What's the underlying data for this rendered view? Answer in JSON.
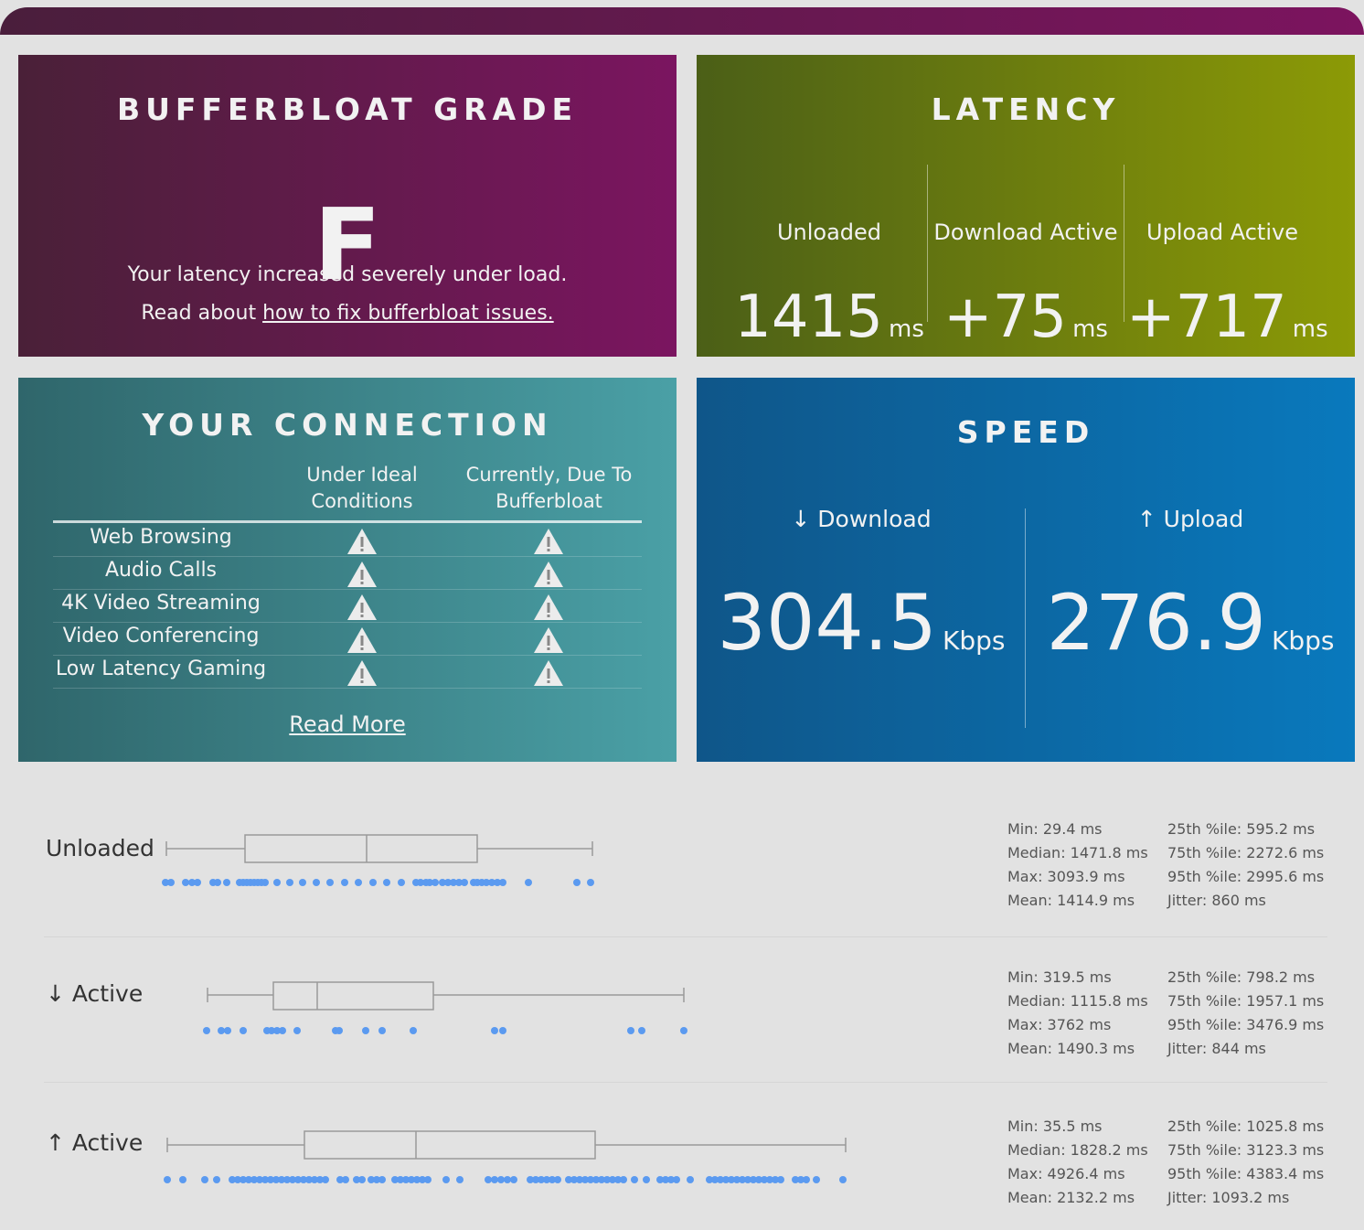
{
  "grade": {
    "title": "BUFFERBLOAT GRADE",
    "letter": "F",
    "message": "Your latency increased severely under load.",
    "read_prefix": "Read about ",
    "link_text": "how to fix bufferbloat issues."
  },
  "latency": {
    "title": "LATENCY",
    "columns": [
      {
        "label": "Unloaded",
        "value": "1415",
        "unit": "ms"
      },
      {
        "label": "Download Active",
        "value": "+75",
        "unit": "ms"
      },
      {
        "label": "Upload Active",
        "value": "+717",
        "unit": "ms"
      }
    ]
  },
  "connection": {
    "title": "YOUR CONNECTION",
    "col_ideal": "Under Ideal Conditions",
    "col_current": "Currently, Due To Bufferbloat",
    "rows": [
      "Web Browsing",
      "Audio Calls",
      "4K Video Streaming",
      "Video Conferencing",
      "Low Latency Gaming"
    ],
    "status_icon": "warning-icon",
    "read_more": "Read More"
  },
  "speed": {
    "title": "SPEED",
    "download": {
      "label": "↓ Download",
      "value": "304.5",
      "unit": "Kbps"
    },
    "upload": {
      "label": "↑ Upload",
      "value": "276.9",
      "unit": "Kbps"
    }
  },
  "stats": [
    {
      "label": "Unloaded",
      "min": "Min: 29.4 ms",
      "median": "Median: 1471.8 ms",
      "max": "Max: 3093.9 ms",
      "mean": "Mean: 1414.9 ms",
      "p25": "25th %ile: 595.2 ms",
      "p75": "75th %ile: 2272.6 ms",
      "p95": "95th %ile: 2995.6 ms",
      "jitter": "Jitter: 860 ms"
    },
    {
      "label": "↓ Active",
      "min": "Min: 319.5 ms",
      "median": "Median: 1115.8 ms",
      "max": "Max: 3762 ms",
      "mean": "Mean: 1490.3 ms",
      "p25": "25th %ile: 798.2 ms",
      "p75": "75th %ile: 1957.1 ms",
      "p95": "95th %ile: 3476.9 ms",
      "jitter": "Jitter: 844 ms"
    },
    {
      "label": "↑ Active",
      "min": "Min: 35.5 ms",
      "median": "Median: 1828.2 ms",
      "max": "Max: 4926.4 ms",
      "mean": "Mean: 2132.2 ms",
      "p25": "25th %ile: 1025.8 ms",
      "p75": "75th %ile: 3123.3 ms",
      "p95": "95th %ile: 4383.4 ms",
      "jitter": "Jitter: 1093.2 ms"
    }
  ],
  "colors": {
    "dot": "#5b9af0",
    "box_stroke": "#9a9a9a"
  }
}
